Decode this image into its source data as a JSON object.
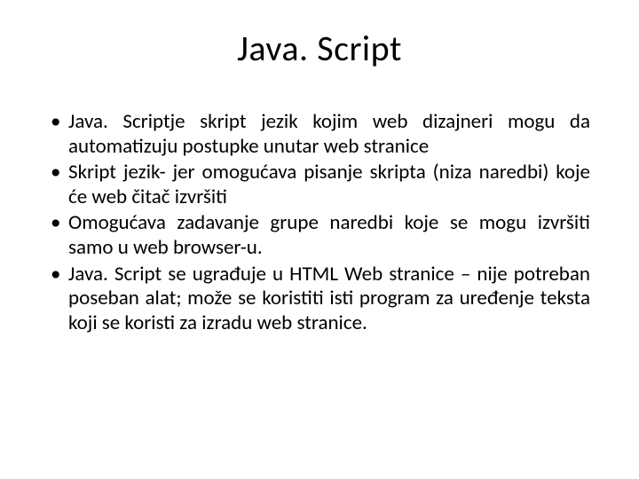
{
  "title": "Java. Script",
  "bullets": [
    "Java. Scriptje skript jezik kojim web dizajneri mogu da automatizuju postupke unutar web stranice",
    "Skript jezik- jer omogućava pisanje skripta (niza naredbi) koje će web čitač izvršiti",
    "Omogućava zadavanje grupe naredbi koje se mogu izvršiti samo u web browser-u.",
    "Java. Script se ugrađuje u HTML Web stranice – nije potreban poseban alat; može se koristiti isti program za uređenje teksta koji se koristi za izradu web stranice."
  ]
}
